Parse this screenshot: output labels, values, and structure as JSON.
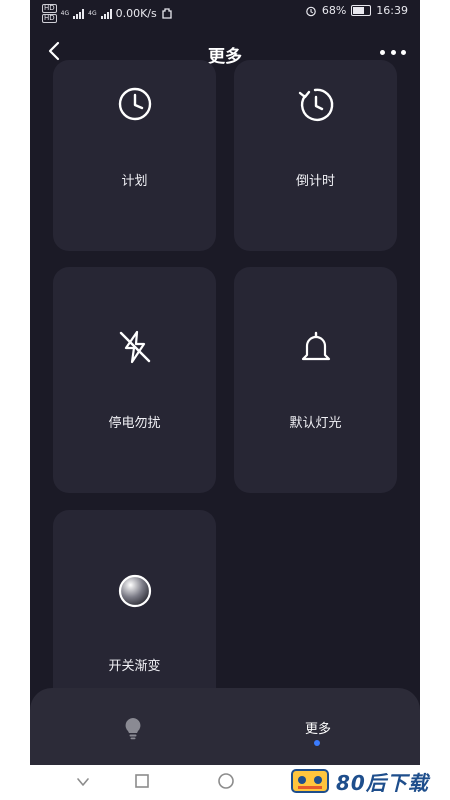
{
  "status_bar": {
    "net1": "HD",
    "net2": "HD",
    "net_type1": "4G",
    "net_type2": "4G",
    "speed": "0.00K/s",
    "battery": "68%",
    "time": "16:39"
  },
  "header": {
    "title": "更多"
  },
  "cards": [
    {
      "label": "计划",
      "icon": "clock-icon"
    },
    {
      "label": "倒计时",
      "icon": "countdown-icon"
    },
    {
      "label": "停电勿扰",
      "icon": "power-off-icon"
    },
    {
      "label": "默认灯光",
      "icon": "bell-icon"
    },
    {
      "label": "开关渐变",
      "icon": "gradient-circle-icon"
    }
  ],
  "bottom_nav": {
    "left_icon": "lightbulb-icon",
    "right_label": "更多",
    "active": "更多",
    "accent": "#3b7cff"
  },
  "watermark": {
    "text": "80后下载"
  },
  "colors": {
    "background": "#1b1a26",
    "card": "#272634",
    "text": "#ffffff"
  }
}
